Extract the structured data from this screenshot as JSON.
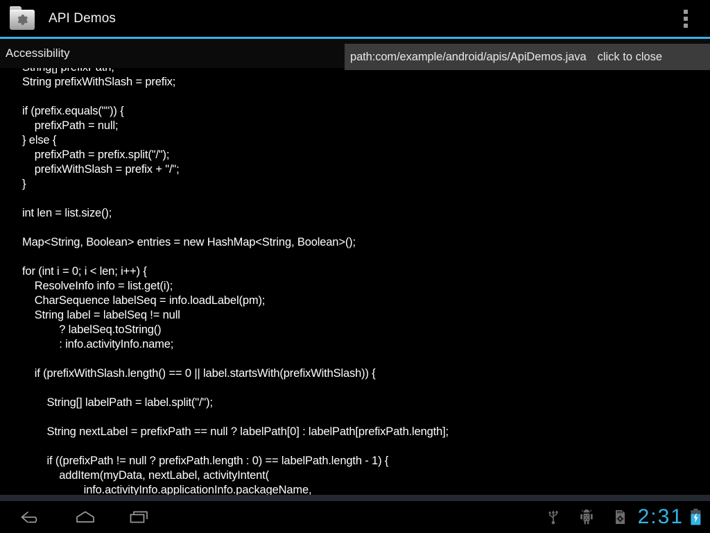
{
  "action_bar": {
    "app_title": "API Demos",
    "app_icon": "folder-gear-icon",
    "overflow_icon": "overflow-menu-icon",
    "accent_color": "#33b5e5"
  },
  "sub_header": {
    "title": "Accessibility"
  },
  "path_overlay": {
    "path_text": "path:com/example/android/apis/ApiDemos.java",
    "close_hint": "click to close",
    "background_color": "#3c3c3c"
  },
  "code": {
    "language": "java",
    "text_color": "#ffffff",
    "background_color": "#000000",
    "lines": [
      "String[] prefixPath;",
      "String prefixWithSlash = prefix;",
      "",
      "if (prefix.equals(\"\")) {",
      "    prefixPath = null;",
      "} else {",
      "    prefixPath = prefix.split(\"/\");",
      "    prefixWithSlash = prefix + \"/\";",
      "}",
      "",
      "int len = list.size();",
      "",
      "Map<String, Boolean> entries = new HashMap<String, Boolean>();",
      "",
      "for (int i = 0; i < len; i++) {",
      "    ResolveInfo info = list.get(i);",
      "    CharSequence labelSeq = info.loadLabel(pm);",
      "    String label = labelSeq != null",
      "            ? labelSeq.toString()",
      "            : info.activityInfo.name;",
      "",
      "    if (prefixWithSlash.length() == 0 || label.startsWith(prefixWithSlash)) {",
      "",
      "        String[] labelPath = label.split(\"/\");",
      "",
      "        String nextLabel = prefixPath == null ? labelPath[0] : labelPath[prefixPath.length];",
      "",
      "        if ((prefixPath != null ? prefixPath.length : 0) == labelPath.length - 1) {",
      "            addItem(myData, nextLabel, activityIntent(",
      "                    info.activityInfo.applicationInfo.packageName,"
    ]
  },
  "nav_bar": {
    "back_icon": "back-arrow-icon",
    "home_icon": "home-icon",
    "recents_icon": "recent-apps-icon"
  },
  "status_tray": {
    "usb_icon": "usb-icon",
    "adb_icon": "android-debug-icon",
    "sdcard_icon": "sdcard-settings-icon",
    "clock": "2:31",
    "clock_color": "#33b5e5",
    "battery_icon": "battery-charging-icon",
    "battery_color": "#33b5e5"
  }
}
